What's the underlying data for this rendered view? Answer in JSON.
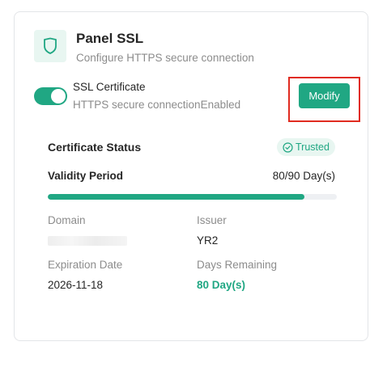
{
  "header": {
    "icon": "shield-icon",
    "title": "Panel SSL",
    "subtitle": "Configure HTTPS secure connection"
  },
  "ssl": {
    "label": "SSL Certificate",
    "status_text": "HTTPS secure connectionEnabled",
    "enabled": true,
    "modify_label": "Modify"
  },
  "certificate": {
    "section_title": "Certificate Status",
    "badge_icon": "check-circle-icon",
    "badge_label": "Trusted",
    "validity_label": "Validity Period",
    "validity_value": "80/90 Day(s)",
    "validity_fraction": 0.889,
    "domain_label": "Domain",
    "issuer_label": "Issuer",
    "issuer_value": "YR2",
    "expiration_label": "Expiration Date",
    "expiration_value": "2026-11-18",
    "remaining_label": "Days Remaining",
    "remaining_value": "80 Day(s)"
  },
  "colors": {
    "accent": "#20a783",
    "accent_light": "#e8f6f1",
    "highlight": "#e02b20"
  }
}
